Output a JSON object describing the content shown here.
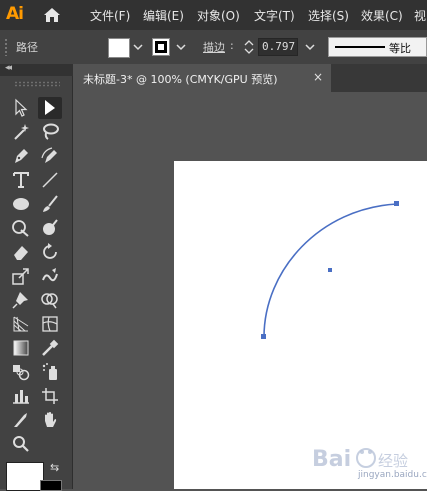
{
  "app": {
    "logo": "Ai"
  },
  "menu": {
    "items": [
      "文件(F)",
      "编辑(E)",
      "对象(O)",
      "文字(T)",
      "选择(S)",
      "效果(C)",
      "视"
    ]
  },
  "control_bar": {
    "selection_label": "路径",
    "stroke_label": "描边",
    "stroke_weight": "0.797",
    "stroke_style_label": "等比"
  },
  "document_tab": {
    "title": "未标题-3* @ 100% (CMYK/GPU 预览)",
    "close": "×"
  },
  "tools": [
    "selection-tool",
    "direct-selection-tool",
    "magic-wand-tool",
    "lasso-tool",
    "pen-tool",
    "curvature-tool",
    "type-tool",
    "line-segment-tool",
    "ellipse-tool",
    "paintbrush-tool",
    "shaper-tool",
    "blob-brush-tool",
    "eraser-tool",
    "rotate-tool",
    "scale-tool",
    "warp-tool",
    "puppet-warp-tool",
    "shape-builder-tool",
    "perspective-grid-tool",
    "mesh-tool",
    "gradient-tool",
    "eyedropper-tool",
    "blend-tool",
    "symbol-sprayer-tool",
    "column-graph-tool",
    "artboard-tool",
    "slice-tool",
    "hand-tool",
    "zoom-tool"
  ],
  "colors": {
    "accent_path": "#4a6fc4",
    "logo": "#ff9a00",
    "canvas": "#535353",
    "artboard": "#ffffff"
  },
  "watermark": {
    "text": "jingyan.baidu.com",
    "logo_text": "Bai 经验"
  }
}
